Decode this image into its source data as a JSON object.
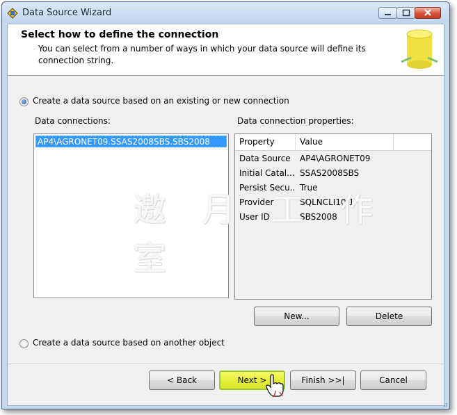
{
  "window": {
    "title": "Data Source Wizard"
  },
  "header": {
    "title": "Select how to define the connection",
    "description": "You can select from a number of ways in which your data source will define its connection string."
  },
  "options": {
    "existing_connection": {
      "label": "Create a data source based on an existing or new connection",
      "checked": true
    },
    "another_object": {
      "label": "Create a data source based on another object",
      "checked": false
    }
  },
  "connections": {
    "label": "Data connections:",
    "items": [
      "AP4\\AGRONET09.SSAS2008SBS.SBS2008"
    ],
    "selected": "AP4\\AGRONET09.SSAS2008SBS.SBS2008"
  },
  "properties": {
    "label": "Data connection properties:",
    "columns": [
      "Property",
      "Value"
    ],
    "rows": [
      {
        "property": "Data Source",
        "value": "AP4\\AGRONET09"
      },
      {
        "property": "Initial Catal...",
        "value": "SSAS2008SBS"
      },
      {
        "property": "Persist Secu...",
        "value": "True"
      },
      {
        "property": "Provider",
        "value": "SQLNCLI10.1"
      },
      {
        "property": "User ID",
        "value": "SBS2008"
      }
    ]
  },
  "buttons": {
    "new": "New...",
    "delete": "Delete",
    "back": "< Back",
    "next": "Next >",
    "finish": "Finish >>|",
    "cancel": "Cancel"
  },
  "watermark": "邀 月 工 作 室",
  "colors": {
    "selection": "#3399ff",
    "focused_button": "#e6f03a",
    "title_bar": "#c9d9ec"
  }
}
